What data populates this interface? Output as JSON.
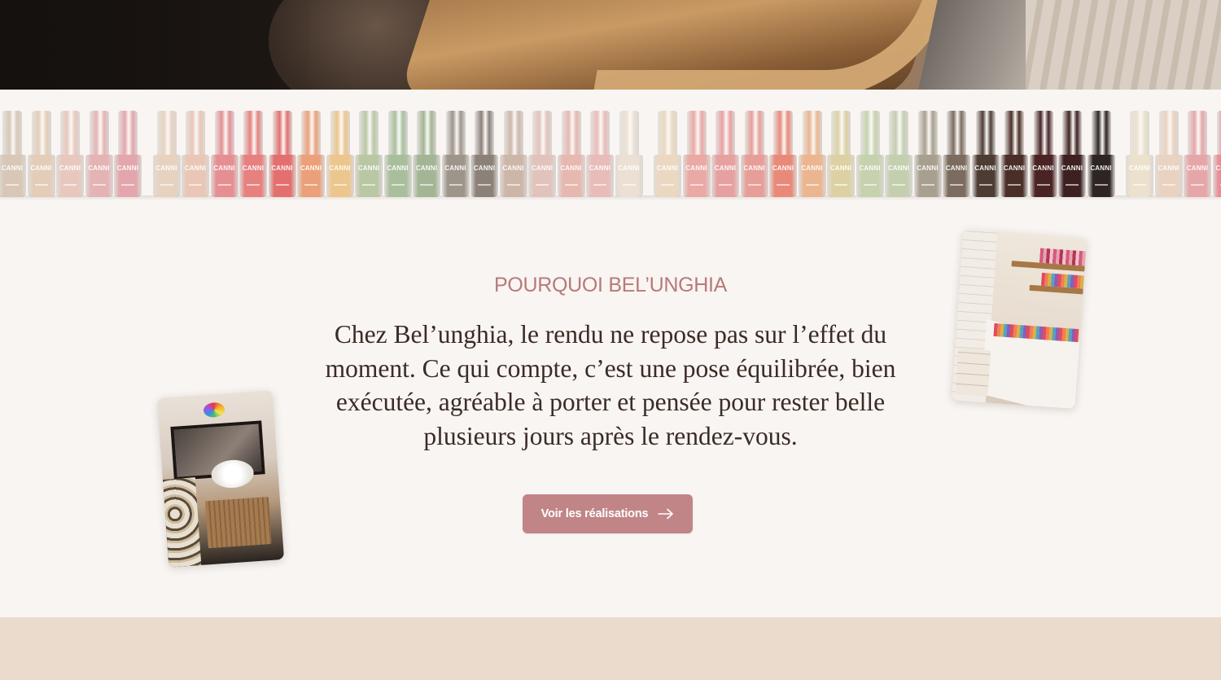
{
  "hero": {
    "image": "salon-interior-photo"
  },
  "bottles_band": {
    "brand": "CANNI",
    "colors": [
      "#d8c7b6",
      "#e4cdb8",
      "#e8c8bd",
      "#e4b3b4",
      "#e3a6ac",
      "#e7d2bf",
      "#e9c6b5",
      "#e58f92",
      "#e6817f",
      "#e3706e",
      "#eba07a",
      "#ecc68c",
      "#b9c7a3",
      "#a9bf9c",
      "#a3b594",
      "#9e958a",
      "#8c8178",
      "#cdb6a8",
      "#e2c3bc",
      "#e6b8b0",
      "#e8bcb8",
      "#ece0d4",
      "#ecd8c0",
      "#eaa9a4",
      "#e7a0a0",
      "#e79e98",
      "#e98a78",
      "#ebb58f",
      "#ddd1a3",
      "#c6d2ad",
      "#c3cfae",
      "#a89f8f",
      "#7b6c5f",
      "#4d3c33",
      "#4a2e27",
      "#4a2324",
      "#3d2121",
      "#2d2423",
      "#ece1cc",
      "#e9d2c0",
      "#e6a6a8",
      "#e98e96"
    ]
  },
  "section": {
    "eyebrow": "POURQUOI BEL’UNGHIA",
    "statement": "Chez Bel’unghia, le rendu ne repose pas sur l’effet du moment. Ce qui compte, c’est une pose équilibrée, bien exécutée, agréable à porter et pensée pour rester belle plusieurs jours après le rendez-vous.",
    "cta_label": "Voir les réalisations",
    "cta_icon": "arrow-right-icon"
  },
  "accent_color": "#c18587"
}
